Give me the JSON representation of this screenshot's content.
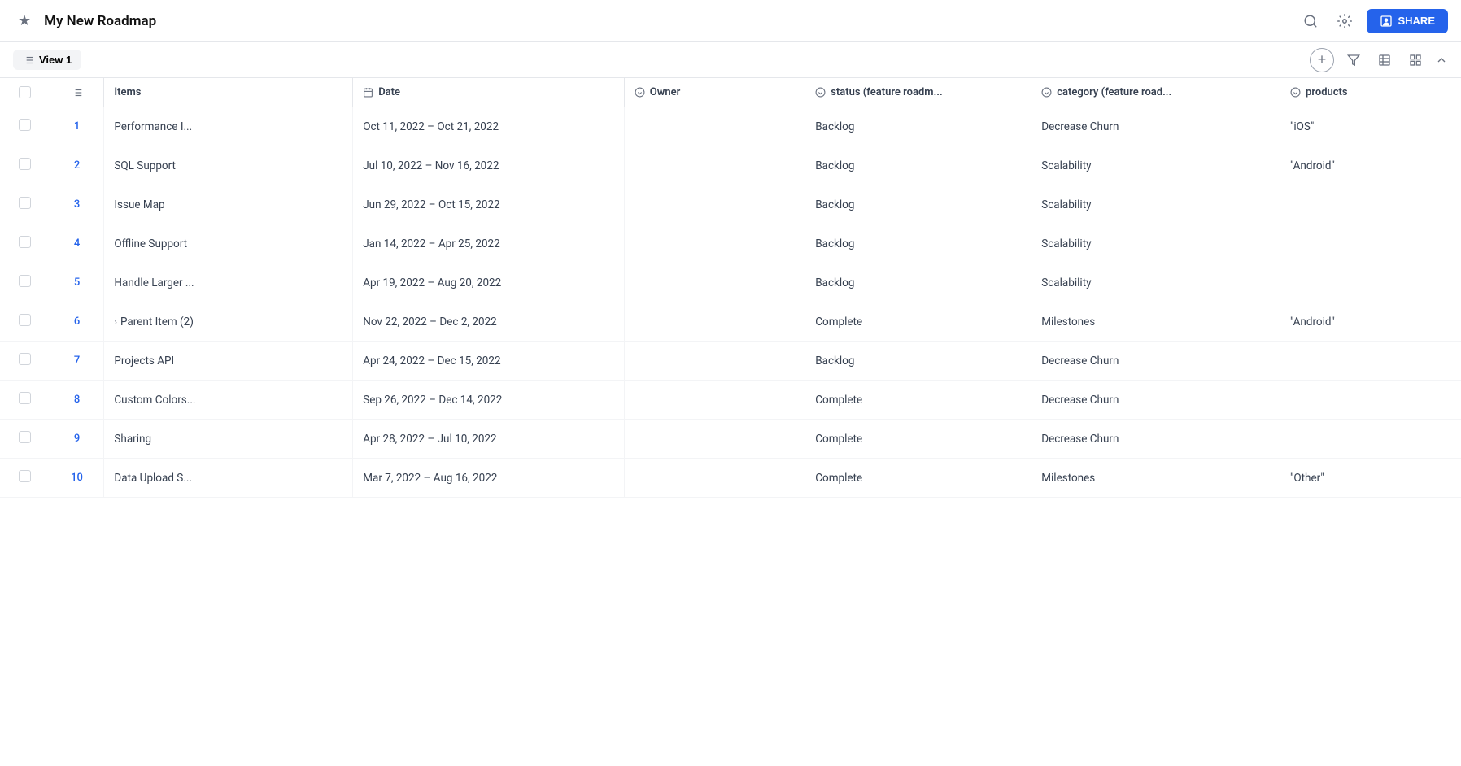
{
  "header": {
    "title": "My New Roadmap",
    "share_label": "SHARE"
  },
  "subheader": {
    "view_label": "View 1"
  },
  "columns": [
    {
      "id": "items",
      "label": "Items",
      "icon": "calendar"
    },
    {
      "id": "date",
      "label": "Date",
      "icon": "calendar"
    },
    {
      "id": "owner",
      "label": "Owner",
      "icon": "circle-chevron-down"
    },
    {
      "id": "status",
      "label": "status (feature roadm...",
      "icon": "circle-chevron-down"
    },
    {
      "id": "category",
      "label": "category (feature road...",
      "icon": "circle-chevron-down"
    },
    {
      "id": "products",
      "label": "products",
      "icon": "circle-chevron-down"
    }
  ],
  "rows": [
    {
      "num": "1",
      "name": "Performance I...",
      "date": "Oct 11, 2022 – Oct 21, 2022",
      "owner": "",
      "status": "Backlog",
      "category": "Decrease Churn",
      "products": "\"iOS\"",
      "expandable": false
    },
    {
      "num": "2",
      "name": "SQL Support",
      "date": "Jul 10, 2022 – Nov 16, 2022",
      "owner": "",
      "status": "Backlog",
      "category": "Scalability",
      "products": "\"Android\"",
      "expandable": false
    },
    {
      "num": "3",
      "name": "Issue Map",
      "date": "Jun 29, 2022 – Oct 15, 2022",
      "owner": "",
      "status": "Backlog",
      "category": "Scalability",
      "products": "",
      "expandable": false
    },
    {
      "num": "4",
      "name": "Offline Support",
      "date": "Jan 14, 2022 – Apr 25, 2022",
      "owner": "",
      "status": "Backlog",
      "category": "Scalability",
      "products": "",
      "expandable": false
    },
    {
      "num": "5",
      "name": "Handle Larger ...",
      "date": "Apr 19, 2022 – Aug 20, 2022",
      "owner": "",
      "status": "Backlog",
      "category": "Scalability",
      "products": "",
      "expandable": false
    },
    {
      "num": "6",
      "name": "Parent Item (2)",
      "date": "Nov 22, 2022 – Dec 2, 2022",
      "owner": "",
      "status": "Complete",
      "category": "Milestones",
      "products": "\"Android\"",
      "expandable": true
    },
    {
      "num": "7",
      "name": "Projects API",
      "date": "Apr 24, 2022 – Dec 15, 2022",
      "owner": "",
      "status": "Backlog",
      "category": "Decrease Churn",
      "products": "",
      "expandable": false
    },
    {
      "num": "8",
      "name": "Custom Colors...",
      "date": "Sep 26, 2022 – Dec 14, 2022",
      "owner": "",
      "status": "Complete",
      "category": "Decrease Churn",
      "products": "",
      "expandable": false
    },
    {
      "num": "9",
      "name": "Sharing",
      "date": "Apr 28, 2022 – Jul 10, 2022",
      "owner": "",
      "status": "Complete",
      "category": "Decrease Churn",
      "products": "",
      "expandable": false
    },
    {
      "num": "10",
      "name": "Data Upload S...",
      "date": "Mar 7, 2022 – Aug 16, 2022",
      "owner": "",
      "status": "Complete",
      "category": "Milestones",
      "products": "\"Other\"",
      "expandable": false
    }
  ]
}
